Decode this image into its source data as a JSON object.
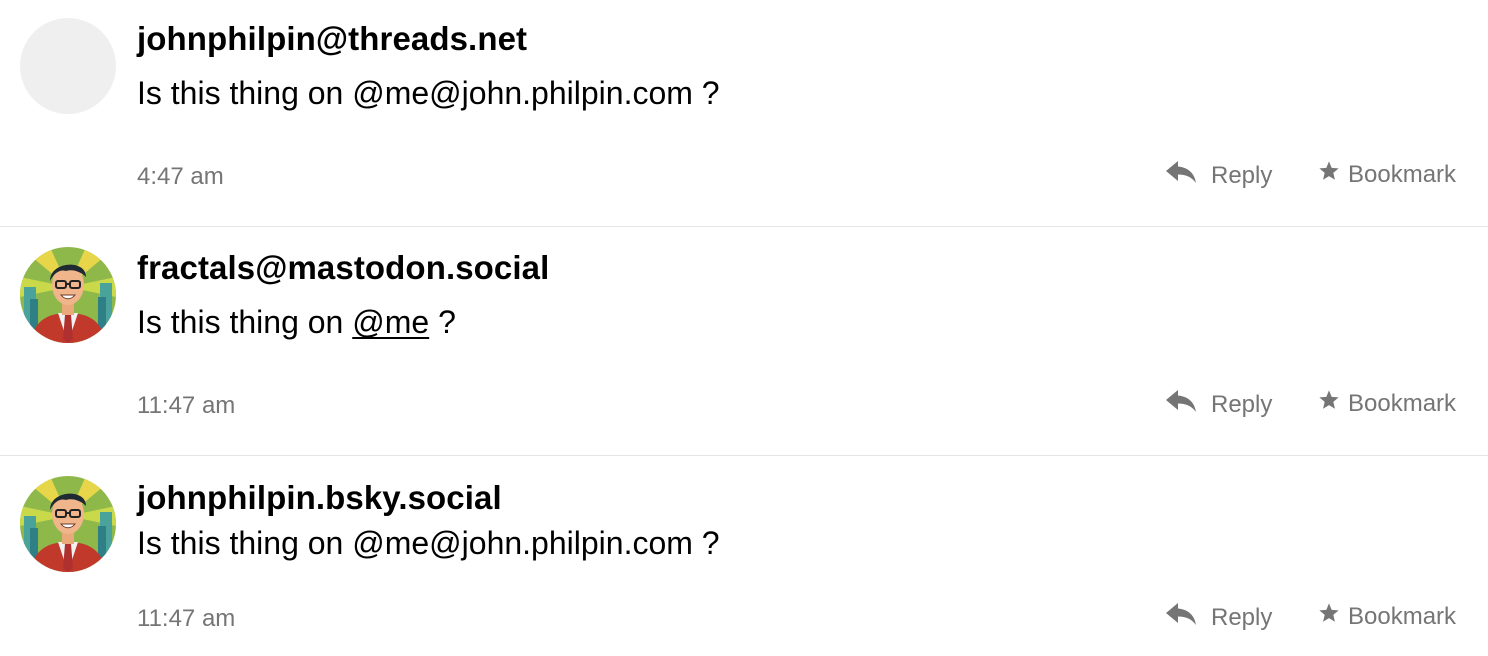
{
  "posts": [
    {
      "handle": "johnphilpin@threads.net",
      "text_before": "Is this thing on @me@john.philpin.com ?",
      "mention": "",
      "text_after": "",
      "time": "4:47 am",
      "avatar": "blank-avatar",
      "reply_label": "Reply",
      "bookmark_label": "Bookmark"
    },
    {
      "handle": "fractals@mastodon.social",
      "text_before": "Is this thing on ",
      "mention": "@me",
      "text_after": " ?",
      "time": "11:47 am",
      "avatar": "cartoon-avatar",
      "reply_label": "Reply",
      "bookmark_label": "Bookmark"
    },
    {
      "handle": "johnphilpin.bsky.social",
      "text_before": "Is this thing on @me@john.philpin.com ?",
      "mention": "",
      "text_after": "",
      "time": "11:47 am",
      "avatar": "cartoon-avatar",
      "reply_label": "Reply",
      "bookmark_label": "Bookmark"
    }
  ],
  "icons": {
    "reply": "reply-arrow-icon",
    "bookmark": "star-icon"
  },
  "colors": {
    "meta_text": "#757575",
    "divider": "#e6e6e6",
    "blank_avatar": "#efefef"
  }
}
